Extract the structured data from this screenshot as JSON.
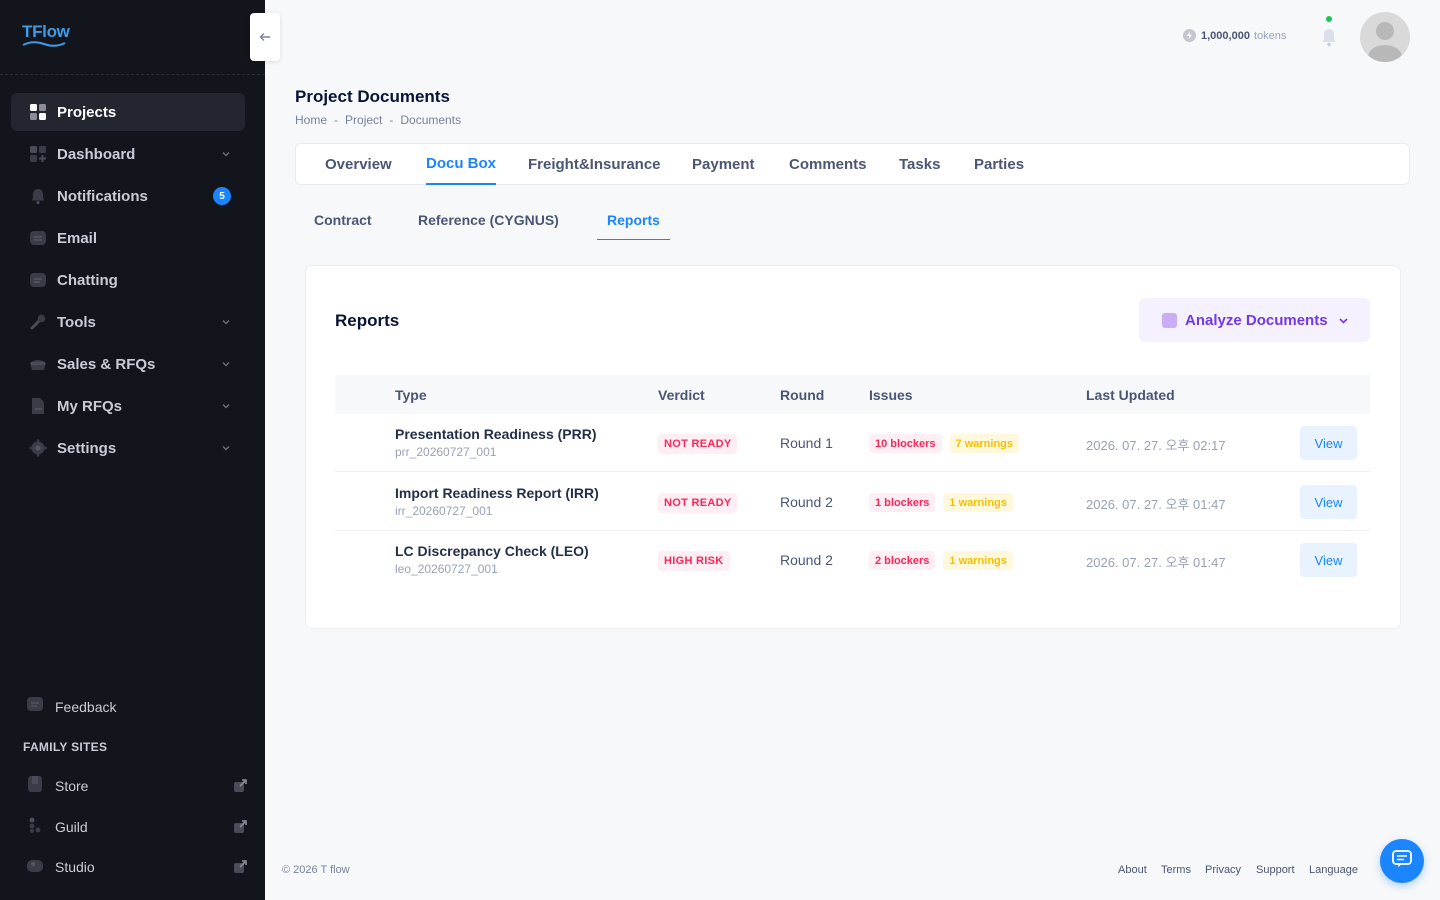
{
  "app": {
    "logo_text": "TFlow"
  },
  "sidebar": {
    "items": [
      {
        "label": "Projects",
        "active": true,
        "icon": "grid-icon"
      },
      {
        "label": "Dashboard",
        "has_chevron": true,
        "icon": "dashboard-icon"
      },
      {
        "label": "Notifications",
        "badge": "5",
        "icon": "bell-icon"
      },
      {
        "label": "Email",
        "icon": "email-icon"
      },
      {
        "label": "Chatting",
        "icon": "chat-icon"
      },
      {
        "label": "Tools",
        "has_chevron": true,
        "icon": "wrench-icon"
      },
      {
        "label": "Sales & RFQs",
        "has_chevron": true,
        "icon": "cart-icon"
      },
      {
        "label": "My RFQs",
        "has_chevron": true,
        "icon": "document-icon"
      },
      {
        "label": "Settings",
        "has_chevron": true,
        "icon": "gear-icon"
      }
    ],
    "feedback_label": "Feedback",
    "family_title": "FAMILY SITES",
    "family_sites": [
      {
        "label": "Store",
        "icon": "store-icon"
      },
      {
        "label": "Guild",
        "icon": "guild-icon"
      },
      {
        "label": "Studio",
        "icon": "studio-icon"
      }
    ]
  },
  "header": {
    "tokens_value": "1,000,000",
    "tokens_unit": "tokens"
  },
  "page": {
    "title": "Project Documents",
    "breadcrumb": [
      "Home",
      "Project",
      "Documents"
    ],
    "breadcrumb_separator": "-"
  },
  "tabs": [
    {
      "label": "Overview"
    },
    {
      "label": "Docu Box",
      "active": true
    },
    {
      "label": "Freight&Insurance"
    },
    {
      "label": "Payment"
    },
    {
      "label": "Comments"
    },
    {
      "label": "Tasks"
    },
    {
      "label": "Parties"
    }
  ],
  "subtabs": [
    {
      "label": "Contract"
    },
    {
      "label": "Reference (CYGNUS)"
    },
    {
      "label": "Reports",
      "active": true
    }
  ],
  "reports": {
    "title": "Reports",
    "analyze_label": "Analyze Documents",
    "columns": [
      "Type",
      "Verdict",
      "Round",
      "Issues",
      "Last Updated"
    ],
    "rows": [
      {
        "name": "Presentation Readiness (PRR)",
        "code": "prr_20260727_001",
        "verdict": "NOT READY",
        "round": "Round 1",
        "blockers": "10 blockers",
        "warnings": "7 warnings",
        "updated": "2026. 07. 27. 오후 02:17",
        "action": "View"
      },
      {
        "name": "Import Readiness Report (IRR)",
        "code": "irr_20260727_001",
        "verdict": "NOT READY",
        "round": "Round 2",
        "blockers": "1 blockers",
        "warnings": "1 warnings",
        "updated": "2026. 07. 27. 오후 01:47",
        "action": "View"
      },
      {
        "name": "LC Discrepancy Check (LEO)",
        "code": "leo_20260727_001",
        "verdict": "HIGH RISK",
        "round": "Round 2",
        "blockers": "2 blockers",
        "warnings": "1 warnings",
        "updated": "2026. 07. 27. 오후 01:47",
        "action": "View"
      }
    ]
  },
  "footer": {
    "copyright": "© 2026 T flow",
    "links": [
      "About",
      "Terms",
      "Privacy",
      "Support",
      "Language"
    ]
  },
  "colors": {
    "accent": "#1b84ff",
    "sidebar_bg": "#13151c",
    "danger": "#f8285a",
    "warning": "#f6c000",
    "purple": "#7239ea"
  }
}
